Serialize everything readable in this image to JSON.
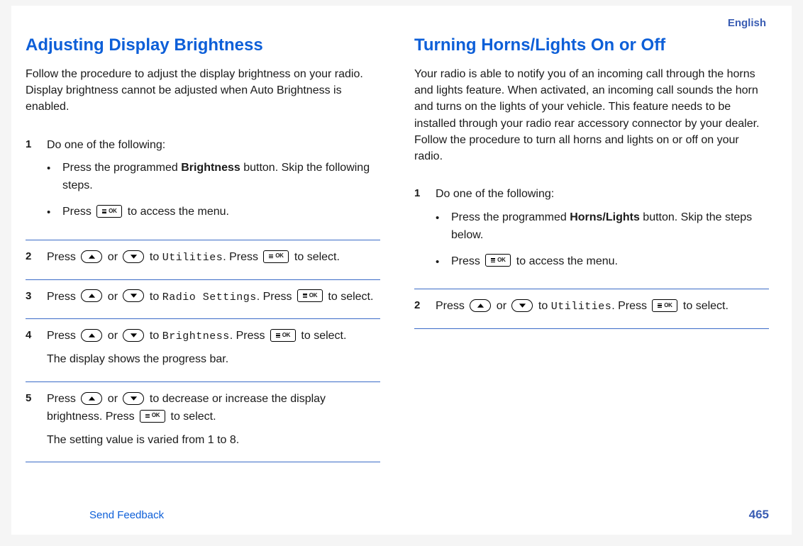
{
  "language": "English",
  "sections": [
    {
      "title": "Adjusting Display Brightness",
      "intro": "Follow the procedure to adjust the display brightness on your radio. Display brightness cannot be adjusted when Auto Brightness is enabled.",
      "steps": [
        {
          "num": "1",
          "lead": "Do one of the following:",
          "bullets": [
            {
              "pre": "Press the programmed ",
              "bold": "Brightness",
              "post": " button. Skip the following steps."
            },
            {
              "pre": "Press ",
              "icon1": "ok",
              "post": " to access the menu."
            }
          ]
        },
        {
          "num": "2",
          "segments": [
            "Press ",
            {
              "icon": "up"
            },
            " or ",
            {
              "icon": "down"
            },
            " to ",
            {
              "mono": "Utilities"
            },
            ". Press ",
            {
              "icon": "ok"
            },
            " to select."
          ]
        },
        {
          "num": "3",
          "segments": [
            "Press ",
            {
              "icon": "up"
            },
            " or ",
            {
              "icon": "down"
            },
            " to ",
            {
              "mono": "Radio Settings"
            },
            ". Press ",
            {
              "icon": "ok"
            },
            " to select."
          ]
        },
        {
          "num": "4",
          "segments": [
            "Press ",
            {
              "icon": "up"
            },
            " or ",
            {
              "icon": "down"
            },
            " to ",
            {
              "mono": "Brightness"
            },
            ". Press ",
            {
              "icon": "ok"
            },
            " to select."
          ],
          "after": "The display shows the progress bar."
        },
        {
          "num": "5",
          "segments": [
            "Press ",
            {
              "icon": "up"
            },
            " or ",
            {
              "icon": "down"
            },
            " to decrease or increase the display brightness. Press ",
            {
              "icon": "ok"
            },
            " to select."
          ],
          "after": "The setting value is varied from 1 to 8."
        }
      ]
    },
    {
      "title": "Turning Horns/Lights On or Off",
      "intro": "Your radio is able to notify you of an incoming call through the horns and lights feature. When activated, an incoming call sounds the horn and turns on the lights of your vehicle. This feature needs to be installed through your radio rear accessory connector by your dealer. Follow the procedure to turn all horns and lights on or off on your radio.",
      "steps": [
        {
          "num": "1",
          "lead": "Do one of the following:",
          "bullets": [
            {
              "pre": "Press the programmed ",
              "bold": "Horns/Lights",
              "post": " button. Skip the steps below."
            },
            {
              "pre": "Press ",
              "icon1": "ok",
              "post": " to access the menu."
            }
          ]
        },
        {
          "num": "2",
          "segments": [
            "Press ",
            {
              "icon": "up"
            },
            " or ",
            {
              "icon": "down"
            },
            " to ",
            {
              "mono": "Utilities"
            },
            ". Press ",
            {
              "icon": "ok"
            },
            " to select."
          ]
        }
      ]
    }
  ],
  "footer": {
    "feedback": "Send Feedback",
    "page": "465"
  },
  "icons": {
    "ok": "menu-ok-button-icon",
    "up": "arrow-up-button-icon",
    "down": "arrow-down-button-icon"
  }
}
